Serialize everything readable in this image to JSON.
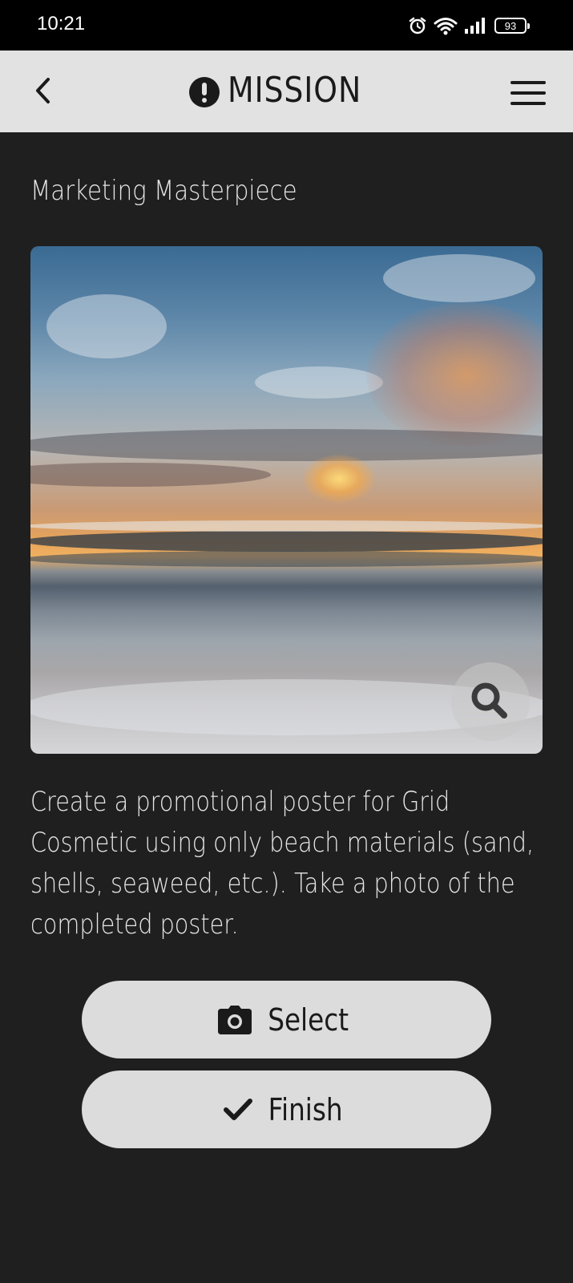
{
  "status_bar": {
    "time": "10:21",
    "battery": "93",
    "icons": [
      "alarm-icon",
      "wifi-icon",
      "signal-icon",
      "battery-icon"
    ]
  },
  "header": {
    "title": "MISSION",
    "back_icon": "chevron-left-icon",
    "title_icon": "exclamation-circle-icon",
    "menu_icon": "hamburger-menu-icon"
  },
  "mission": {
    "name": "Marketing Masterpiece",
    "image": "sunset-beach-photo",
    "zoom_icon": "search-icon",
    "description": "Create a promotional poster for Grid Cosmetic using only beach materials (sand, shells, seaweed, etc.). Take a photo of the completed poster."
  },
  "actions": {
    "select_label": "Select",
    "select_icon": "camera-icon",
    "finish_label": "Finish",
    "finish_icon": "check-icon"
  },
  "colors": {
    "background": "#1f1f1f",
    "header": "#e2e2e2",
    "button": "#dcdcdc",
    "text_light": "#e6e6e6",
    "text_dark": "#1a1a1a"
  }
}
